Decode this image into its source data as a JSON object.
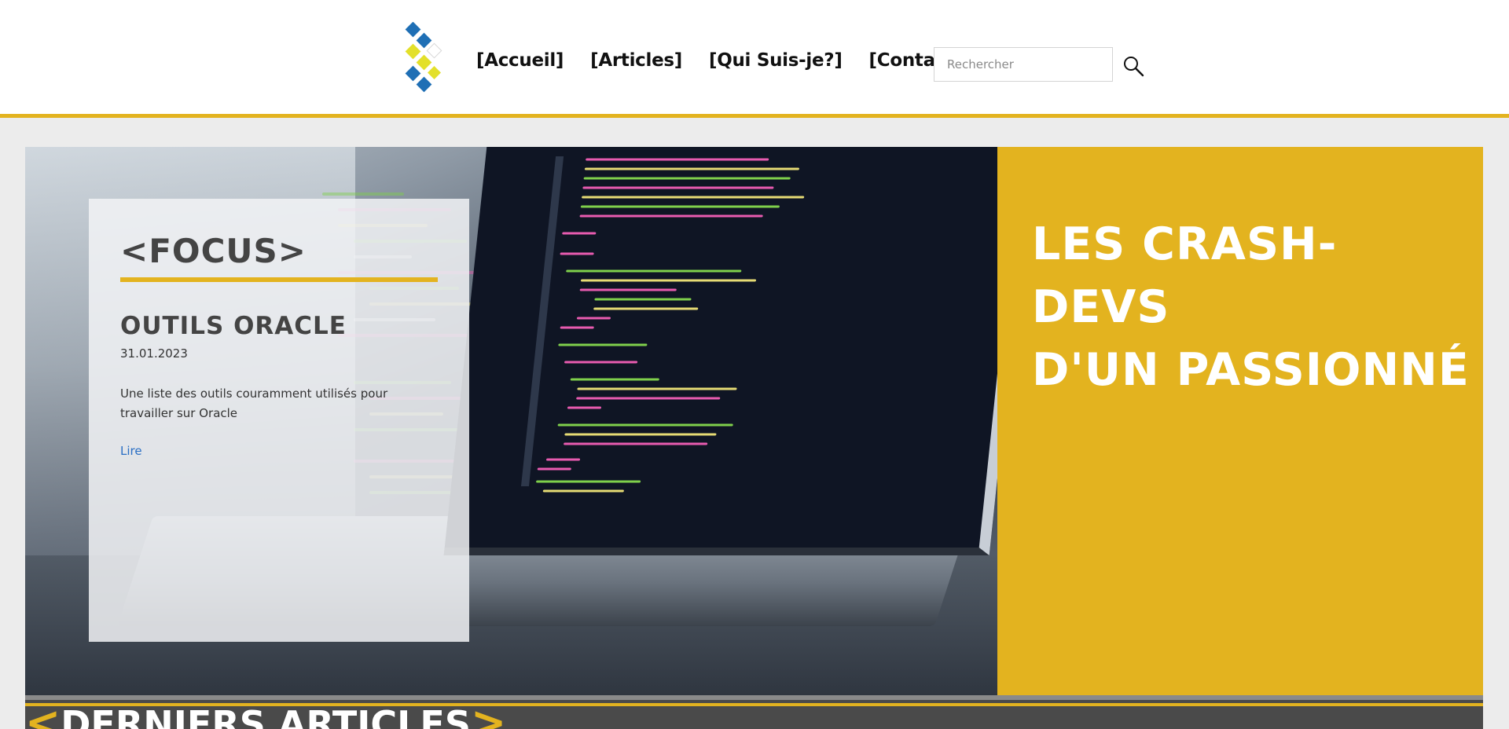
{
  "nav": {
    "items": [
      {
        "label": "[Accueil]"
      },
      {
        "label": "[Articles]"
      },
      {
        "label": "[Qui Suis-je?]"
      },
      {
        "label": "[Contact]"
      }
    ]
  },
  "search": {
    "placeholder": "Rechercher",
    "value": "",
    "icon": "search-icon"
  },
  "logo": {
    "icon": "diamond-chevron-logo",
    "colors": [
      "#1f6fb5",
      "#e3e02a",
      "#ffffff"
    ]
  },
  "focus": {
    "heading": "<FOCUS>",
    "article_title": "OUTILS ORACLE",
    "date": "31.01.2023",
    "summary": "Une liste des outils couramment utilisés pour travailler sur Oracle",
    "link_label": "Lire"
  },
  "tagline": {
    "line1": "LES CRASH-DEVS",
    "line2": "D'UN PASSIONNÉ"
  },
  "section": {
    "bracket_open": "<",
    "title": "DERNIERS ARTICLES",
    "bracket_close": ">"
  },
  "colors": {
    "accent": "#e3b31f",
    "dark": "#4a4a4a",
    "link": "#2a6fc4"
  }
}
